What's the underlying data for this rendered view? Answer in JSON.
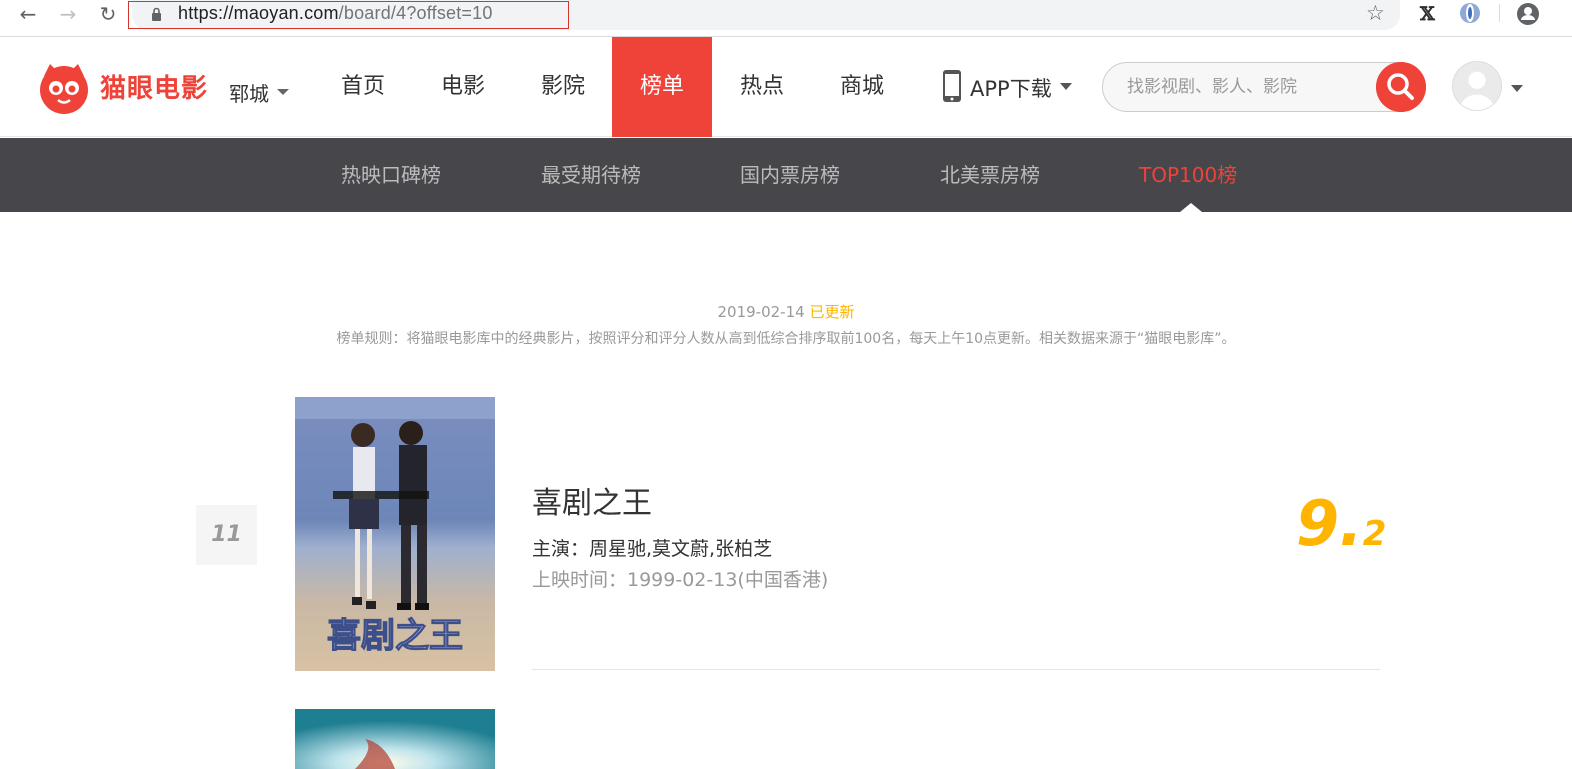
{
  "browser": {
    "url_host": "https://maoyan.com",
    "url_path": "/board/4?offset=10"
  },
  "header": {
    "logo_text": "猫眼电影",
    "city": "郓城",
    "nav": [
      "首页",
      "电影",
      "影院",
      "榜单",
      "热点",
      "商城"
    ],
    "active_nav": "榜单",
    "app_download": "APP下载",
    "search_placeholder": "找影视剧、影人、影院"
  },
  "subnav": {
    "items": [
      "热映口碑榜",
      "最受期待榜",
      "国内票房榜",
      "北美票房榜",
      "TOP100榜"
    ],
    "active": "TOP100榜"
  },
  "board": {
    "update_date": "2019-02-14",
    "update_status": "已更新",
    "rule": "榜单规则：将猫眼电影库中的经典影片，按照评分和评分人数从高到低综合排序取前100名，每天上午10点更新。相关数据来源于“猫眼电影库”。"
  },
  "movies": [
    {
      "rank": "11",
      "title": "喜剧之王",
      "stars": "主演：周星驰,莫文蔚,张柏芝",
      "release": "上映时间：1999-02-13(中国香港)",
      "score_int": "9.",
      "score_frac": "2",
      "poster_caption": "喜剧之王"
    }
  ],
  "colors": {
    "brand": "#ef4238",
    "score": "#ffb400",
    "subnav_bg": "#47464a"
  }
}
